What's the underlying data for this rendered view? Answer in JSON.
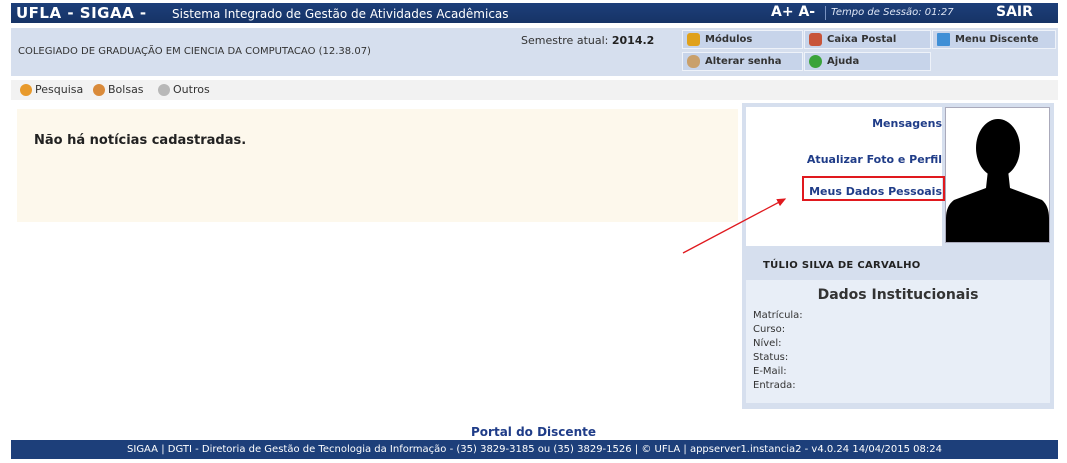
{
  "topbar": {
    "brand": "UFLA - SIGAA -",
    "system_name": "Sistema Integrado de Gestão de Atividades Acadêmicas",
    "font_controls": "A+ A-",
    "session_label": "Tempo de Sessão: 01:27",
    "logout": "SAIR"
  },
  "header": {
    "course": "COLEGIADO DE GRADUAÇÃO EM CIENCIA DA COMPUTACAO (12.38.07)",
    "semester_label": "Semestre atual:",
    "semester_value": "2014.2",
    "menu": {
      "modulos": "Módulos",
      "caixa_postal": "Caixa Postal",
      "menu_discente": "Menu Discente",
      "alterar_senha": "Alterar senha",
      "ajuda": "Ajuda"
    }
  },
  "subnav": {
    "pesquisa": "Pesquisa",
    "bolsas": "Bolsas",
    "outros": "Outros"
  },
  "news": {
    "empty_message": "Não há notícias cadastradas."
  },
  "profile": {
    "links": {
      "mensagens": "Mensagens",
      "atualizar": "Atualizar Foto e Perfil",
      "dados_pessoais": "Meus Dados Pessoais"
    },
    "name": "TÚLIO SILVA DE CARVALHO",
    "institutional_title": "Dados Institucionais",
    "fields": {
      "matricula": "Matrícula:",
      "curso": "Curso:",
      "nivel": "Nível:",
      "status": "Status:",
      "email": "E-Mail:",
      "entrada": "Entrada:"
    }
  },
  "footer": {
    "portal": "Portal do Discente",
    "text": "SIGAA | DGTI - Diretoria de Gestão de Tecnologia da Informação - (35) 3829-3185 ou (35) 3829-1526 | © UFLA | appserver1.instancia2 - v4.0.24 14/04/2015 08:24"
  },
  "colors": {
    "brand_blue": "#1d3f7a",
    "panel_blue": "#d6dfee",
    "link_blue": "#1f3c88",
    "highlight_red": "#e0191e"
  },
  "icons": [
    "modules-icon",
    "mailbox-icon",
    "menu-icon",
    "password-icon",
    "help-icon",
    "research-icon",
    "scholarship-icon",
    "others-icon",
    "silhouette-icon"
  ]
}
